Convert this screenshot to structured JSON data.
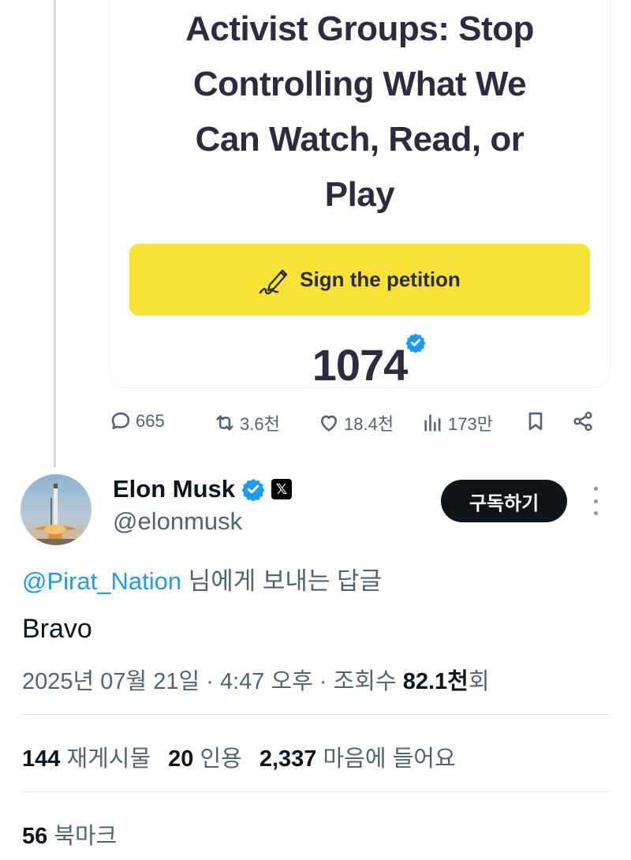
{
  "embedded_card": {
    "headline_lines": [
      "Activist Groups: Stop",
      "Controlling What We",
      "Can Watch, Read, or",
      "Play"
    ],
    "petition_button_label": "Sign the petition",
    "signature_count": "1074"
  },
  "parent_actions": {
    "replies": "665",
    "reposts": "3.6천",
    "likes": "18.4천",
    "views": "173만"
  },
  "tweet": {
    "author_name": "Elon Musk",
    "author_handle": "@elonmusk",
    "subscribe_label": "구독하기",
    "reply_to_handle": "@Pirat_Nation",
    "reply_to_suffix": " 님에게 보내는 답글",
    "text": "Bravo",
    "timestamp": "2025년 07월 21일 · 4:47 오후 · 조회수 ",
    "views_count": "82.1천",
    "views_suffix": "회"
  },
  "stats": {
    "reposts_count": "144",
    "reposts_label": " 재게시물",
    "quotes_count": "20",
    "quotes_label": " 인용",
    "likes_count": "2,337",
    "likes_label": " 마음에 들어요",
    "bookmarks_count": "56",
    "bookmarks_label": " 북마크"
  },
  "colors": {
    "petition_button": "#f7e236",
    "headline": "#2e2a3f",
    "link": "#1d9bf0",
    "verified": "#1d9bf0",
    "subscribe_bg": "#0f1419"
  }
}
